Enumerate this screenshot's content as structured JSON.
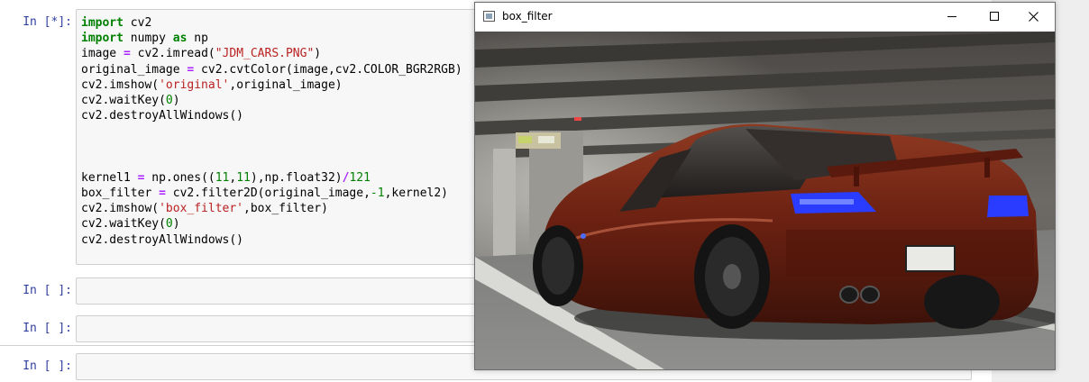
{
  "notebook": {
    "cells": [
      {
        "prompt": "In [*]:",
        "lines": [
          [
            {
              "t": "import",
              "c": "kw"
            },
            {
              "t": " cv2"
            }
          ],
          [
            {
              "t": "import",
              "c": "kw"
            },
            {
              "t": " numpy "
            },
            {
              "t": "as",
              "c": "kw"
            },
            {
              "t": " np"
            }
          ],
          [
            {
              "t": "image "
            },
            {
              "t": "=",
              "c": "op"
            },
            {
              "t": " cv2.imread("
            },
            {
              "t": "\"JDM_CARS.PNG\"",
              "c": "str"
            },
            {
              "t": ")"
            }
          ],
          [
            {
              "t": "original_image "
            },
            {
              "t": "=",
              "c": "op"
            },
            {
              "t": " cv2.cvtColor(image,cv2.COLOR_BGR2RGB)"
            }
          ],
          [
            {
              "t": "cv2.imshow("
            },
            {
              "t": "'original'",
              "c": "str"
            },
            {
              "t": ",original_image)"
            }
          ],
          [
            {
              "t": "cv2.waitKey("
            },
            {
              "t": "0",
              "c": "num"
            },
            {
              "t": ")"
            }
          ],
          [
            {
              "t": "cv2.destroyAllWindows()"
            }
          ],
          [],
          [],
          [],
          [
            {
              "t": "kernel1 "
            },
            {
              "t": "=",
              "c": "op"
            },
            {
              "t": " np.ones(("
            },
            {
              "t": "11",
              "c": "num"
            },
            {
              "t": ","
            },
            {
              "t": "11",
              "c": "num"
            },
            {
              "t": "),np.float32)"
            },
            {
              "t": "/",
              "c": "op"
            },
            {
              "t": "121",
              "c": "num"
            }
          ],
          [
            {
              "t": "box_filter "
            },
            {
              "t": "=",
              "c": "op"
            },
            {
              "t": " cv2.filter2D(original_image,"
            },
            {
              "t": "-1",
              "c": "num"
            },
            {
              "t": ",kernel2)"
            }
          ],
          [
            {
              "t": "cv2.imshow("
            },
            {
              "t": "'box_filter'",
              "c": "str"
            },
            {
              "t": ",box_filter)"
            }
          ],
          [
            {
              "t": "cv2.waitKey("
            },
            {
              "t": "0",
              "c": "num"
            },
            {
              "t": ")"
            }
          ],
          [
            {
              "t": "cv2.destroyAllWindows()"
            }
          ]
        ]
      },
      {
        "prompt": "In [ ]:"
      },
      {
        "prompt": "In [ ]:"
      },
      {
        "prompt": "In [ ]:"
      }
    ]
  },
  "window": {
    "title": "box_filter",
    "icons": {
      "app": "opencv-window-icon",
      "minimize": "minimize-icon",
      "maximize": "maximize-icon",
      "close": "close-icon"
    }
  },
  "colors": {
    "prompt": "#303f9f",
    "keyword": "#008000",
    "string": "#ba2121",
    "operator": "#aa22ff",
    "car_body": "#7a2414",
    "taillight": "#2a3cff"
  }
}
